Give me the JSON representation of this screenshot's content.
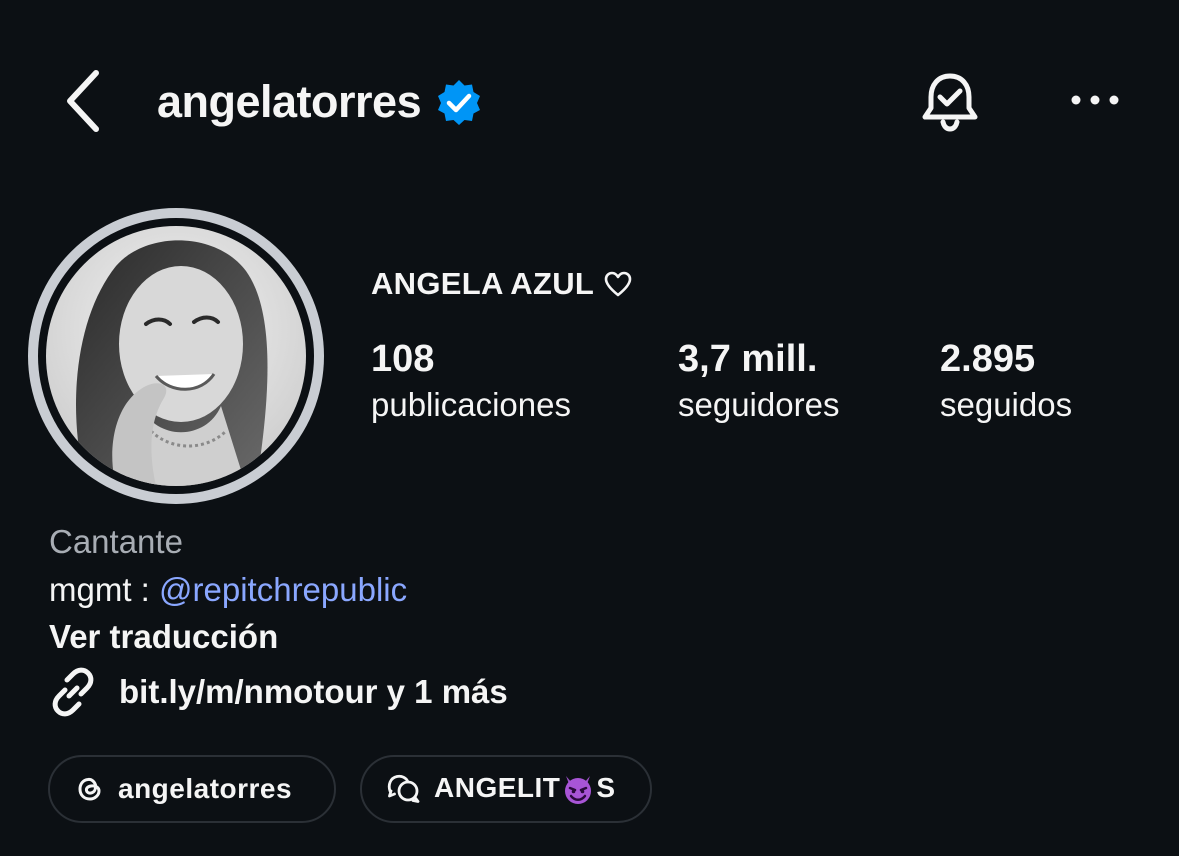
{
  "header": {
    "username": "angelatorres",
    "verified": true,
    "back_icon": "chevron-left-icon",
    "notifications_icon": "bell-check-icon",
    "more_icon": "more-horizontal-icon",
    "verified_color": "#0095f6"
  },
  "profile": {
    "display_name": "ANGELA AZUL",
    "name_icon": "heart-outline-icon",
    "stats": [
      {
        "value": "108",
        "label": "publicaciones"
      },
      {
        "value": "3,7 mill.",
        "label": "seguidores"
      },
      {
        "value": "2.895",
        "label": "seguidos"
      }
    ]
  },
  "bio": {
    "category": "Cantante",
    "mgmt_prefix": "mgmt : ",
    "mention": "@repitchrepublic",
    "translate_label": "Ver traducción",
    "link_text": "bit.ly/m/nmotour y 1 más",
    "link_icon": "link-icon"
  },
  "chips": {
    "threads_label": "angelatorres",
    "threads_icon": "threads-icon",
    "channel_label_start": "ANGELIT",
    "channel_emoji": "smiling-imp-emoji",
    "channel_label_end": "S",
    "channel_icon": "broadcast-chat-icon"
  },
  "colors": {
    "background": "#0c1014",
    "text": "#f5f5f5",
    "muted": "#a8adb4",
    "link": "#8aa7ff",
    "ring": "#c9cdd3"
  }
}
